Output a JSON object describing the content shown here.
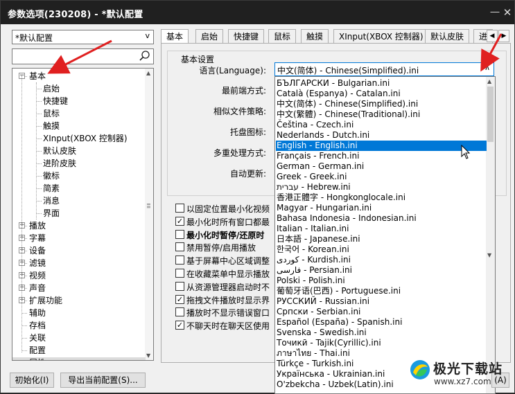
{
  "window": {
    "title": "参数选项(230208) - *默认配置"
  },
  "preset_combo": {
    "value": "*默认配置"
  },
  "search": {
    "placeholder": ""
  },
  "tree": {
    "items": [
      {
        "label": "基本",
        "expanded": true
      },
      {
        "label": "启始"
      },
      {
        "label": "快捷键"
      },
      {
        "label": "鼠标"
      },
      {
        "label": "触摸"
      },
      {
        "label": "XInput(XBOX 控制器)"
      },
      {
        "label": "默认皮肤"
      },
      {
        "label": "进阶皮肤"
      },
      {
        "label": "徽标"
      },
      {
        "label": "简素"
      },
      {
        "label": "消息"
      },
      {
        "label": "界面"
      },
      {
        "label": "播放",
        "expanded": false
      },
      {
        "label": "字幕",
        "expanded": false
      },
      {
        "label": "设备",
        "expanded": false
      },
      {
        "label": "滤镜",
        "expanded": false
      },
      {
        "label": "视频",
        "expanded": false
      },
      {
        "label": "声音",
        "expanded": false
      },
      {
        "label": "扩展功能",
        "expanded": false
      },
      {
        "label": "辅助"
      },
      {
        "label": "存档"
      },
      {
        "label": "关联"
      },
      {
        "label": "配置"
      },
      {
        "label": "属性"
      }
    ]
  },
  "tabs": [
    "基本",
    "启始",
    "快捷键",
    "鼠标",
    "触摸",
    "XInput(XBOX 控制器)",
    "默认皮肤",
    "进"
  ],
  "group": {
    "title": "基本设置"
  },
  "fields": {
    "language": "语言(Language):",
    "front": "最前端方式:",
    "similar": "相似文件策略:",
    "tray": "托盘图标:",
    "multi": "多重处理方式:",
    "autoupdate": "自动更新:"
  },
  "language_value": "中文(简体) - Chinese(Simplified).ini",
  "checkboxes": [
    {
      "label": "以固定位置最小化视频",
      "checked": false
    },
    {
      "label": "最小化时所有窗口都最",
      "checked": true
    },
    {
      "label": "最小化时暂停/还原时",
      "checked": false
    },
    {
      "label": "禁用暂停/启用播放",
      "checked": false
    },
    {
      "label": "基于屏幕中心区域调整",
      "checked": false
    },
    {
      "label": "在收藏菜单中显示播放",
      "checked": false
    },
    {
      "label": "从资源管理器启动时不",
      "checked": false
    },
    {
      "label": "拖拽文件播放时显示界",
      "checked": true
    },
    {
      "label": "播放时不显示错误窗口",
      "checked": false
    },
    {
      "label": "不聊天时在聊天区使用",
      "checked": true
    }
  ],
  "language_options": [
    "БЪЛГАРСКИ - Bulgarian.ini",
    "Català (Espanya) - Catalan.ini",
    "中文(简体) - Chinese(Simplified).ini",
    "中文(繁體) - Chinese(Traditional).ini",
    "Čeština - Czech.ini",
    "Nederlands - Dutch.ini",
    "English - English.ini",
    "Français - French.ini",
    "German - German.ini",
    "Greek - Greek.ini",
    "עברית - Hebrew.ini",
    "香港正體字 - Hongkonglocale.ini",
    "Magyar - Hungarian.ini",
    "Bahasa Indonesia - Indonesian.ini",
    "Italian - Italian.ini",
    "日本語 - Japanese.ini",
    "한국어 - Korean.ini",
    "كوردى - Kurdish.ini",
    "فارسی - Persian.ini",
    "Polski - Polish.ini",
    "葡萄牙语(巴西) - Portuguese.ini",
    "РУССКИЙ - Russian.ini",
    "Српски - Serbian.ini",
    "Español (España) - Spanish.ini",
    "Svenska - Swedish.ini",
    "Точикӣ - Tajik(Cyrillic).ini",
    "ภาษาไทย - Thai.ini",
    "Türkçe - Turkish.ini",
    "Українська - Ukrainian.ini",
    "O'zbekcha - Uzbek(Latin).ini"
  ],
  "highlighted_option": "English - English.ini",
  "buttons": {
    "init": "初始化(I)",
    "export": "导出当前配置(S)...",
    "apply": "(A)"
  },
  "watermark": {
    "title": "极光下载站",
    "url": "www.xz7.com"
  },
  "colors": {
    "accent": "#0078d7",
    "arrow": "#e02020",
    "titlebar": "#202020"
  }
}
